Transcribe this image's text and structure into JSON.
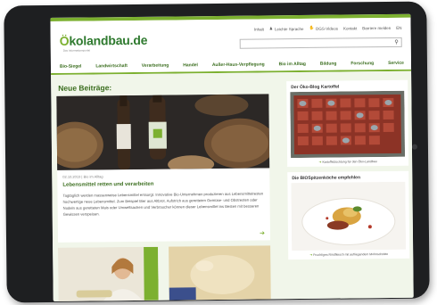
{
  "site": {
    "logo_prefix": "Ö",
    "logo_main": "kolandbau",
    "logo_tld": ".de",
    "tagline": "Das Informationsportal"
  },
  "service_links": [
    "Inhalt",
    "Leichte Sprache",
    "DGS-Videos",
    "Kontakt",
    "Barriere melden",
    "EN"
  ],
  "search": {
    "placeholder": ""
  },
  "nav": [
    "Bio-Siegel",
    "Landwirtschaft",
    "Verarbeitung",
    "Handel",
    "Außer-Haus-Verpflegung",
    "Bio im Alltag",
    "Bildung",
    "Forschung",
    "Service"
  ],
  "main": {
    "section_title": "Neue Beiträge:",
    "article": {
      "meta": "02.10.2019 | Bio im Alltag",
      "title": "Lebensmittel retten und verarbeiten",
      "text": "Tagtäglich werden massenweise Lebensmittel entsorgt. Innovative Bio-Unternehmen produzieren aus Lebensmittelresten hochwertige neue Lebensmittel. Zum Beispiel Bier aus Altbrot. Aufstrich aus geretteten Gemüse- und Obstresten oder Nudeln aus geretteten Mais oder Umweltsachen und Verbraucher können dieser Lebensmittel ins Besten mit besseren Gewissen verspeisen."
    }
  },
  "sidebar": {
    "card1": {
      "title": "Der Öko-Blog Kartoffel",
      "caption": "Kartoffelzüchtung für den Öko-Landbau"
    },
    "card2": {
      "title": "Die BIOSpitzenköche empfehlen",
      "caption": "Fruchtiges Rindfleisch mit aufliegendem Mohnschnitte"
    }
  },
  "colors": {
    "brand_green": "#7cb030",
    "dark_green": "#3b6e1f",
    "page_bg": "#f1f6ea",
    "tablet": "#1e1f21"
  }
}
